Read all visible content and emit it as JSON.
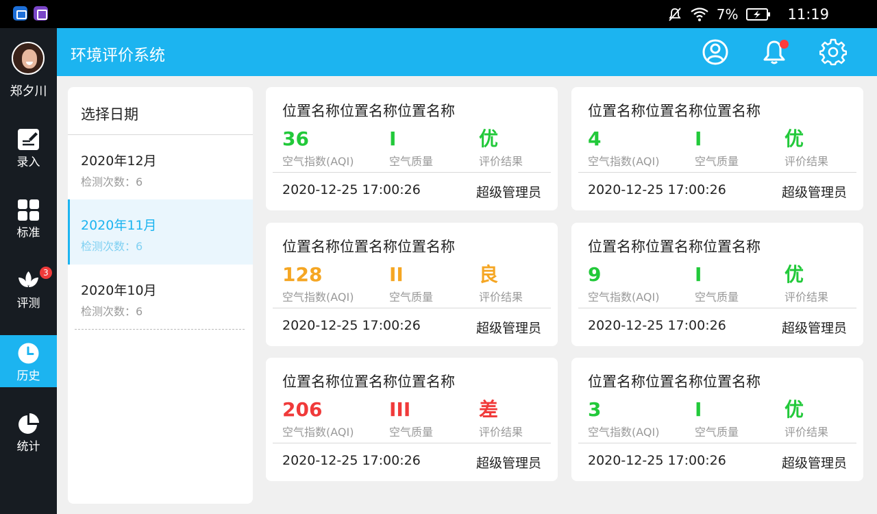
{
  "status_bar": {
    "battery": "7%",
    "time": "11:19"
  },
  "user": {
    "name": "郑夕川"
  },
  "nav": {
    "items": [
      {
        "label": "录入",
        "icon": "edit-icon"
      },
      {
        "label": "标准",
        "icon": "grid-icon"
      },
      {
        "label": "评测",
        "icon": "lotus-icon",
        "badge": "3"
      },
      {
        "label": "历史",
        "icon": "clock-icon",
        "active": true
      },
      {
        "label": "统计",
        "icon": "pie-chart-icon"
      }
    ]
  },
  "header": {
    "title": "环境评价系统"
  },
  "date_panel": {
    "title": "选择日期",
    "items": [
      {
        "month": "2020年12月",
        "count": "检测次数：6"
      },
      {
        "month": "2020年11月",
        "count": "检测次数：6",
        "selected": true
      },
      {
        "month": "2020年10月",
        "count": "检测次数：6"
      }
    ]
  },
  "labels": {
    "aqi": "空气指数(AQI)",
    "quality": "空气质量",
    "result": "评价结果"
  },
  "colors": {
    "accent": "#1cb4f0",
    "good": "#22c93a",
    "moderate": "#f5a623",
    "poor": "#f03a3a"
  },
  "records": [
    {
      "location": "位置名称位置名称位置名称",
      "aqi": "36",
      "quality": "I",
      "result": "优",
      "status": "good",
      "time": "2020-12-25 17:00:26",
      "operator": "超级管理员"
    },
    {
      "location": "位置名称位置名称位置名称",
      "aqi": "4",
      "quality": "I",
      "result": "优",
      "status": "good",
      "time": "2020-12-25 17:00:26",
      "operator": "超级管理员"
    },
    {
      "location": "位置名称位置名称位置名称",
      "aqi": "128",
      "quality": "II",
      "result": "良",
      "status": "moderate",
      "time": "2020-12-25 17:00:26",
      "operator": "超级管理员"
    },
    {
      "location": "位置名称位置名称位置名称",
      "aqi": "9",
      "quality": "I",
      "result": "优",
      "status": "good",
      "time": "2020-12-25 17:00:26",
      "operator": "超级管理员"
    },
    {
      "location": "位置名称位置名称位置名称",
      "aqi": "206",
      "quality": "III",
      "result": "差",
      "status": "poor",
      "time": "2020-12-25 17:00:26",
      "operator": "超级管理员"
    },
    {
      "location": "位置名称位置名称位置名称",
      "aqi": "3",
      "quality": "I",
      "result": "优",
      "status": "good",
      "time": "2020-12-25 17:00:26",
      "operator": "超级管理员"
    }
  ]
}
